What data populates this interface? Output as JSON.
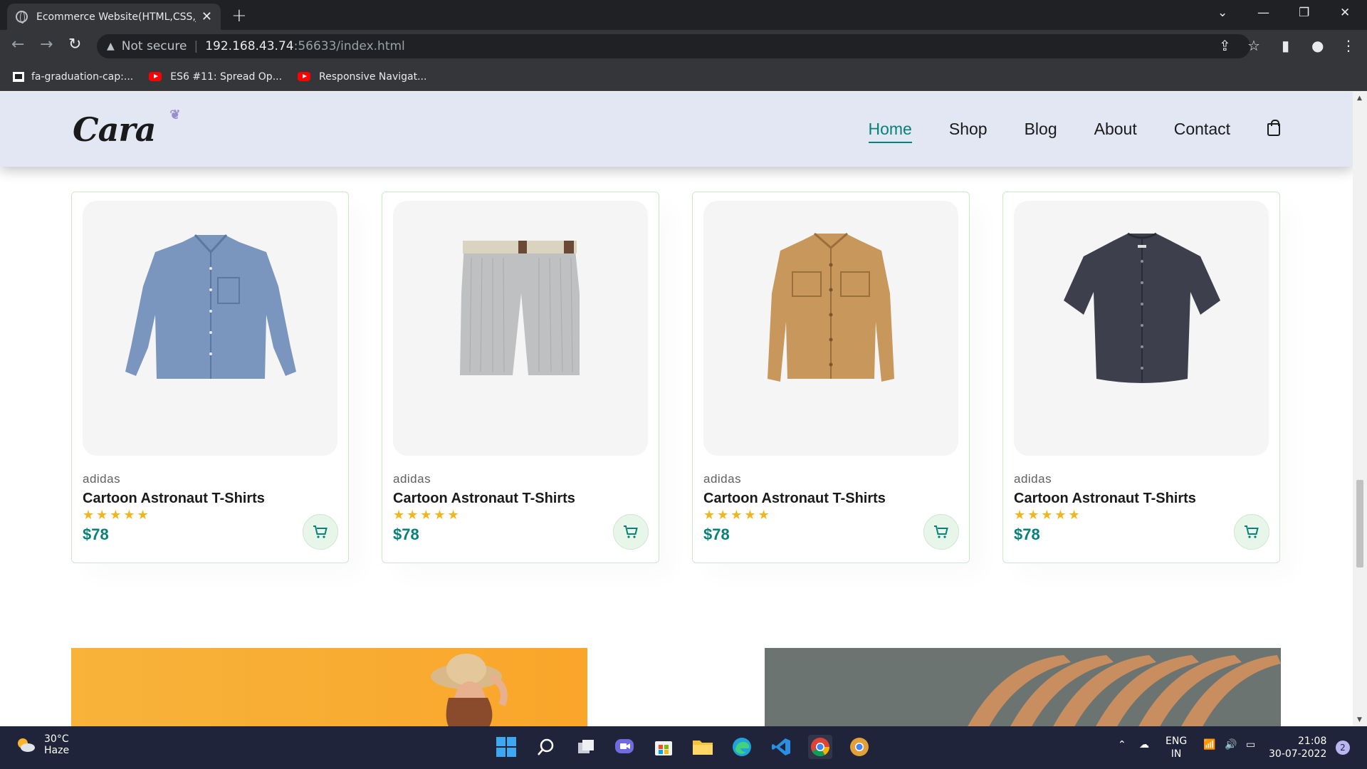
{
  "browser": {
    "tab_title": "Ecommerce Website(HTML,CSS,J",
    "url_warning": "Not secure",
    "url_host": "192.168.43.74",
    "url_path": ":56633/index.html",
    "bookmarks": [
      "fa-graduation-cap:...",
      "ES6 #11: Spread Op...",
      "Responsive Navigat..."
    ]
  },
  "site": {
    "logo": "Cara",
    "nav": [
      "Home",
      "Shop",
      "Blog",
      "About",
      "Contact"
    ],
    "active_nav": "Home",
    "accent_color": "#088178",
    "header_bg": "#e3e6f3"
  },
  "products": [
    {
      "brand": "adidas",
      "name": "Cartoon Astronaut T-Shirts",
      "stars": "★★★★★",
      "price": "$78",
      "image": "blue-denim-shirt"
    },
    {
      "brand": "adidas",
      "name": "Cartoon Astronaut T-Shirts",
      "stars": "★★★★★",
      "price": "$78",
      "image": "grey-striped-shorts"
    },
    {
      "brand": "adidas",
      "name": "Cartoon Astronaut T-Shirts",
      "stars": "★★★★★",
      "price": "$78",
      "image": "tan-overshirt"
    },
    {
      "brand": "adidas",
      "name": "Cartoon Astronaut T-Shirts",
      "stars": "★★★★★",
      "price": "$78",
      "image": "charcoal-short-sleeve-shirt"
    }
  ],
  "taskbar": {
    "temp": "30°C",
    "condition": "Haze",
    "lang": "ENG",
    "region": "IN",
    "time": "21:08",
    "date": "30-07-2022",
    "notifications": "2"
  }
}
